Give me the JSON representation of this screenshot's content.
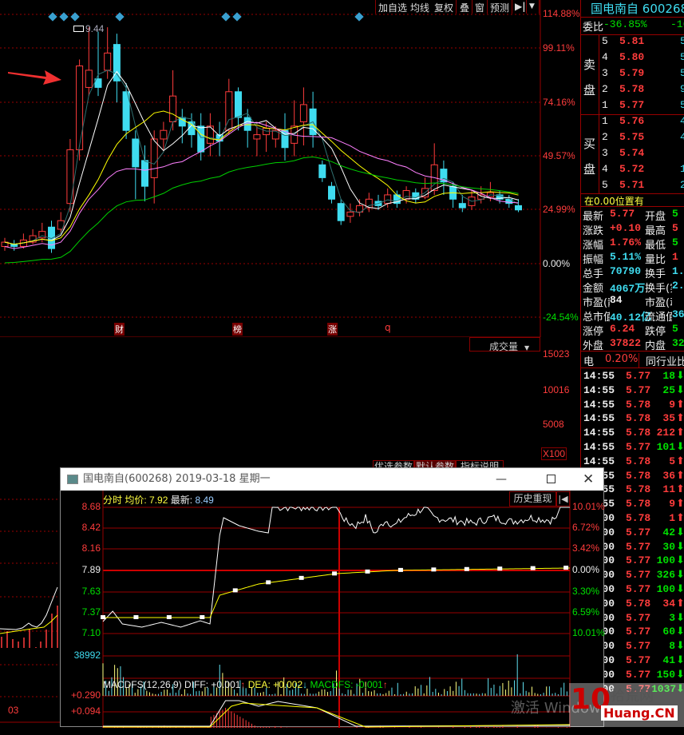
{
  "toolbar": {
    "items": [
      "加自选",
      "均线",
      "复权",
      "叠",
      "窗",
      "预测"
    ],
    "arrow_icon": "goto-end-icon",
    "dropdown_icon": "chevron-down-icon"
  },
  "kline": {
    "axis_pct": [
      "114.88%",
      "99.11%",
      "74.16%",
      "49.57%",
      "24.99%",
      "0.00%",
      "-24.54%"
    ],
    "high_label": "9.44",
    "event_markers": [
      "财",
      "榜",
      "涨",
      "q"
    ],
    "colors": {
      "up": "#ff3c3c",
      "down": "#3fdcf0",
      "ma_lines": [
        "#2f6f6f",
        "#ffffff",
        "#ffff00",
        "#ff80ff",
        "#00d000"
      ]
    },
    "candles_pct_ohlc": [
      [
        8,
        10,
        12,
        6
      ],
      [
        9,
        8,
        11,
        6
      ],
      [
        8,
        11,
        14,
        7
      ],
      [
        10,
        13,
        16,
        9
      ],
      [
        12,
        15,
        19,
        10
      ],
      [
        17,
        7,
        20,
        5
      ],
      [
        16,
        20,
        24,
        14
      ],
      [
        28,
        53,
        58,
        24
      ],
      [
        53,
        92,
        95,
        48
      ],
      [
        82,
        90,
        110,
        78
      ],
      [
        86,
        82,
        108,
        78
      ],
      [
        90,
        98,
        110,
        86
      ],
      [
        102,
        85,
        107,
        75
      ],
      [
        80,
        62,
        84,
        58
      ],
      [
        58,
        45,
        62,
        30
      ],
      [
        48,
        36,
        55,
        29
      ],
      [
        40,
        58,
        62,
        28
      ],
      [
        58,
        62,
        66,
        52
      ],
      [
        66,
        78,
        90,
        62
      ],
      [
        68,
        64,
        72,
        56
      ],
      [
        66,
        60,
        70,
        54
      ],
      [
        64,
        52,
        70,
        48
      ],
      [
        56,
        64,
        70,
        50
      ],
      [
        60,
        57,
        66,
        50
      ],
      [
        62,
        80,
        86,
        60
      ],
      [
        80,
        68,
        82,
        62
      ],
      [
        68,
        62,
        72,
        54
      ],
      [
        58,
        60,
        64,
        50
      ],
      [
        60,
        63,
        66,
        52
      ],
      [
        58,
        62,
        64,
        54
      ],
      [
        62,
        54,
        70,
        48
      ],
      [
        56,
        64,
        76,
        50
      ],
      [
        66,
        74,
        82,
        55
      ],
      [
        72,
        60,
        80,
        54
      ],
      [
        46,
        40,
        48,
        38
      ],
      [
        36,
        30,
        38,
        28
      ],
      [
        28,
        20,
        30,
        18
      ],
      [
        22,
        24,
        28,
        19
      ],
      [
        24,
        27,
        30,
        22
      ],
      [
        26,
        30,
        33,
        24
      ],
      [
        29,
        27,
        32,
        25
      ],
      [
        28,
        32,
        35,
        26
      ],
      [
        32,
        28,
        34,
        26
      ],
      [
        30,
        34,
        36,
        28
      ],
      [
        33,
        30,
        35,
        28
      ],
      [
        31,
        35,
        40,
        30
      ],
      [
        34,
        46,
        56,
        32
      ],
      [
        44,
        38,
        48,
        32
      ],
      [
        36,
        30,
        38,
        26
      ],
      [
        28,
        26,
        32,
        24
      ],
      [
        27,
        31,
        34,
        25
      ],
      [
        30,
        32,
        36,
        28
      ],
      [
        31,
        33,
        38,
        29
      ],
      [
        32,
        30,
        34,
        28
      ],
      [
        30,
        28,
        32,
        26
      ],
      [
        27,
        25,
        30,
        24
      ]
    ],
    "ma_periods": [
      3,
      5,
      10,
      20,
      40
    ]
  },
  "volume": {
    "dropdown": "成交量",
    "axis": [
      "15023",
      "10016",
      "5008"
    ],
    "unit": "X100",
    "colors": [
      "#ff3c3c",
      "#3fdcf0",
      "#ffff00",
      "#ffffff",
      "#4040ff"
    ],
    "values": [
      600,
      900,
      1500,
      1600,
      2800,
      1900,
      600,
      300,
      5000,
      10000,
      12700,
      13800,
      14000,
      12300,
      10300,
      8500,
      6700,
      5800,
      6000,
      6000,
      6400,
      8400,
      4600,
      4300,
      3700,
      3600,
      3000,
      8400,
      5100,
      4000,
      3900,
      3000,
      3200,
      2800,
      4700,
      3600,
      3100,
      2800,
      2700,
      2600,
      2300,
      2600,
      2800,
      3000,
      2400,
      2000,
      2300,
      2600,
      4000,
      5500,
      2000,
      2100,
      1800,
      1600,
      1400,
      1300
    ]
  },
  "tabs": [
    "优选参数",
    "默认参数",
    "指标说明"
  ],
  "left_bottom": {
    "date_label": "03"
  },
  "popup": {
    "title": "国电南自(600268) 2019-03-18 星期一",
    "app_icon": "window-icon",
    "minimize": "minimize-icon",
    "maximize": "maximize-icon",
    "close": "close-icon",
    "header": {
      "label": "分时",
      "avg_label": "均价:",
      "avg": "7.92",
      "last_label": "最新:",
      "last": "8.49"
    },
    "history_button": "历史重现",
    "back_icon": "rewind-icon",
    "price_axis": [
      "8.68",
      "8.42",
      "8.16",
      "7.89",
      "7.63",
      "7.37",
      "7.10"
    ],
    "pct_axis": [
      "10.01%",
      "6.72%",
      "3.42%",
      "0.00%",
      "3.30%",
      "6.59%",
      "10.01%"
    ],
    "volume_axis": "38992",
    "macd_header": {
      "name": "MACDFS(12,26,9)",
      "diff": "DIFF: +0.001",
      "diff_arrow": "↑",
      "dea": "DEA: +0.002",
      "dea_arrow": "↓",
      "macdfs": "MACDFS: -0.001",
      "macdfs_arrow": "↑"
    },
    "macd_axis": [
      "+0.290",
      "+0.094"
    ],
    "price_points": [
      [
        0,
        7.25
      ],
      [
        5,
        7.38
      ],
      [
        10,
        7.22
      ],
      [
        20,
        7.18
      ],
      [
        30,
        7.24
      ],
      [
        40,
        7.18
      ],
      [
        50,
        7.26
      ],
      [
        55,
        7.22
      ],
      [
        60,
        8.33
      ],
      [
        62,
        8.55
      ],
      [
        70,
        8.45
      ],
      [
        80,
        8.38
      ],
      [
        85,
        8.36
      ],
      [
        87,
        8.68
      ],
      [
        120,
        8.68
      ],
      [
        125,
        8.5
      ],
      [
        130,
        8.45
      ],
      [
        135,
        8.55
      ],
      [
        140,
        8.35
      ],
      [
        145,
        8.52
      ],
      [
        150,
        8.45
      ],
      [
        155,
        8.55
      ],
      [
        160,
        8.6
      ],
      [
        165,
        8.68
      ],
      [
        170,
        8.55
      ],
      [
        180,
        8.52
      ],
      [
        190,
        8.48
      ],
      [
        200,
        8.55
      ],
      [
        210,
        8.5
      ],
      [
        220,
        8.55
      ],
      [
        230,
        8.52
      ],
      [
        233,
        8.55
      ],
      [
        235,
        8.68
      ],
      [
        240,
        8.68
      ]
    ],
    "avg_points": [
      [
        0,
        7.3
      ],
      [
        55,
        7.3
      ],
      [
        60,
        7.58
      ],
      [
        80,
        7.72
      ],
      [
        120,
        7.85
      ],
      [
        150,
        7.89
      ],
      [
        240,
        7.92
      ]
    ]
  },
  "quote": {
    "name": "国电南自",
    "code": "600268",
    "ratio_label": "委比",
    "ratio": "-36.85%",
    "ratio_diff": "-16",
    "sell_label": "卖盘",
    "buy_label": "买盘",
    "sell": [
      [
        "5",
        "5.81",
        "5"
      ],
      [
        "4",
        "5.80",
        "5"
      ],
      [
        "3",
        "5.79",
        "5"
      ],
      [
        "2",
        "5.78",
        "9"
      ],
      [
        "1",
        "5.77",
        "5"
      ]
    ],
    "buy": [
      [
        "1",
        "5.76",
        "4"
      ],
      [
        "2",
        "5.75",
        "4"
      ],
      [
        "3",
        "5.74",
        ""
      ],
      [
        "4",
        "5.72",
        "1"
      ],
      [
        "5",
        "5.71",
        "2"
      ]
    ],
    "position_note": "在0.00位置有",
    "stats": [
      {
        "l": "最新",
        "v": "5.77",
        "c": "red",
        "l2": "开盘",
        "v2": "5",
        "c2": "grn"
      },
      {
        "l": "涨跌",
        "v": "+0.10",
        "c": "red",
        "l2": "最高",
        "v2": "5",
        "c2": "red"
      },
      {
        "l": "涨幅",
        "v": "1.76%",
        "c": "red",
        "l2": "最低",
        "v2": "5",
        "c2": "grn"
      },
      {
        "l": "振幅",
        "v": "5.11%",
        "c": "cy",
        "l2": "量比",
        "v2": "1",
        "c2": "red"
      },
      {
        "l": "总手",
        "v": "70790",
        "c": "cy",
        "l2": "换手",
        "v2": "1.1",
        "c2": "cy"
      },
      {
        "l": "金额",
        "v": "4067万",
        "c": "cy",
        "l2": "换手(实)",
        "v2": "2.2",
        "c2": "cy"
      },
      {
        "l": "市盈(静)",
        "v": "84",
        "c": "wh",
        "l2": "市盈(动)",
        "v2": "",
        "c2": "wh"
      },
      {
        "l": "总市值",
        "v": "40.12亿",
        "c": "cy",
        "l2": "流通值",
        "v2": "36.05",
        "c2": "cy"
      },
      {
        "l": "涨停",
        "v": "6.24",
        "c": "red",
        "l2": "跌停",
        "v2": "5",
        "c2": "grn"
      },
      {
        "l": "外盘",
        "v": "37822",
        "c": "red",
        "l2": "内盘",
        "v2": "329",
        "c2": "grn"
      }
    ],
    "sector_label": "电",
    "sector_pct": "0.20%",
    "peer_button": "同行业比较",
    "trades": [
      [
        "14:55",
        "5.77",
        "18",
        "down"
      ],
      [
        "14:55",
        "5.77",
        "25",
        "down"
      ],
      [
        "14:55",
        "5.78",
        "9",
        "up"
      ],
      [
        "14:55",
        "5.78",
        "35",
        "up"
      ],
      [
        "14:55",
        "5.78",
        "212",
        "up"
      ],
      [
        "14:55",
        "5.77",
        "101",
        "down"
      ],
      [
        "14:55",
        "5.78",
        "5",
        "up"
      ],
      [
        "14:55",
        "5.78",
        "36",
        "up"
      ],
      [
        "14:55",
        "5.78",
        "11",
        "up"
      ],
      [
        "14:55",
        "5.78",
        "9",
        "up"
      ],
      [
        "15:00",
        "5.78",
        "1",
        "up"
      ],
      [
        "15:00",
        "5.77",
        "42",
        "down"
      ],
      [
        "15:00",
        "5.77",
        "30",
        "down"
      ],
      [
        "15:00",
        "5.77",
        "100",
        "down"
      ],
      [
        "15:00",
        "5.77",
        "326",
        "down"
      ],
      [
        "15:00",
        "5.77",
        "100",
        "down"
      ],
      [
        "15:00",
        "5.78",
        "34",
        "up"
      ],
      [
        "15:00",
        "5.77",
        "3",
        "down"
      ],
      [
        "15:00",
        "5.77",
        "60",
        "down"
      ],
      [
        "15:00",
        "5.77",
        "8",
        "down"
      ],
      [
        "15:00",
        "5.77",
        "41",
        "down"
      ],
      [
        "15:00",
        "5.77",
        "150",
        "down"
      ],
      [
        "15:00",
        "5.77",
        "1037",
        "down"
      ]
    ]
  },
  "watermark": {
    "logo_text": "10 拾荒网 Huang.CN",
    "os_text": "激活 Windows"
  }
}
